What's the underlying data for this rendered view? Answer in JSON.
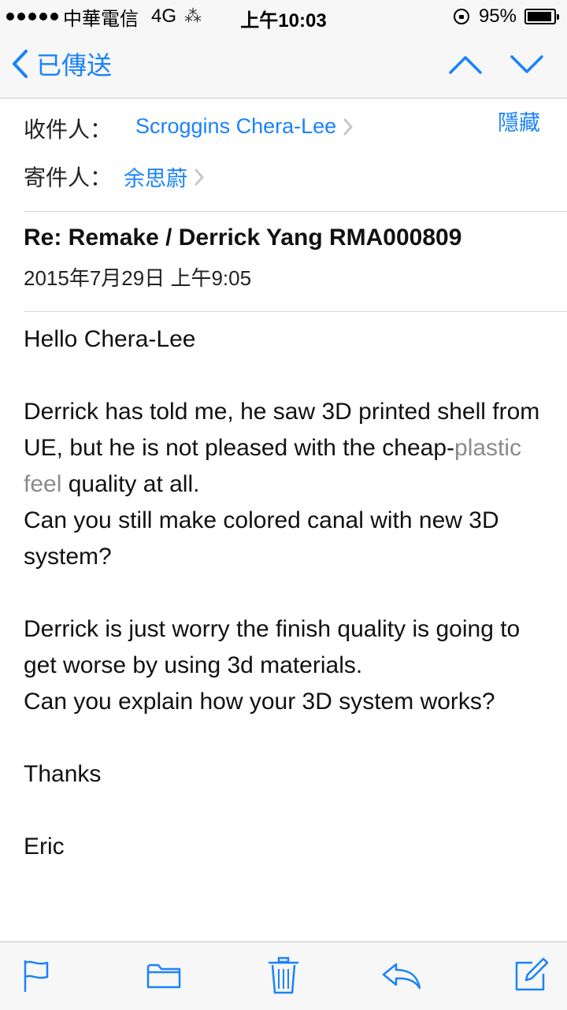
{
  "status_bar": {
    "carrier": "中華電信",
    "network": "4G",
    "time": "上午10:03",
    "battery": "95%",
    "battery_level": 0.95
  },
  "nav": {
    "back_label": "已傳送",
    "icons": [
      "chevron-left-icon",
      "chevron-up-icon",
      "chevron-down-icon"
    ]
  },
  "header": {
    "to_label": "收件人：",
    "to_value": "Scroggins Chera-Lee",
    "from_label": "寄件人：",
    "from_value": "余思蔚",
    "hide_label": "隱藏",
    "subject": "Re: Remake / Derrick Yang RMA000809",
    "date": "2015年7月29日 上午9:05"
  },
  "body": {
    "greeting": "Hello Chera-Lee",
    "p1_a": "Derrick has told me, he saw 3D printed shell from UE, but he is not pleased with the cheap-",
    "p1_muted": "plastic feel",
    "p1_b": " quality at all.",
    "p1_c": "Can you still make colored canal with new 3D system?",
    "p2_a": "Derrick is just worry the finish quality is going to get worse by using 3d materials.",
    "p2_b": "Can you explain how your 3D system works?",
    "thanks": "Thanks",
    "signature": "Eric"
  },
  "toolbar": {
    "icons": [
      "flag-icon",
      "folder-icon",
      "trash-icon",
      "reply-icon",
      "compose-icon"
    ]
  },
  "colors": {
    "accent": "#1a82fb",
    "bar_bg": "#f7f7f8",
    "muted_text": "#8a8a8f"
  }
}
